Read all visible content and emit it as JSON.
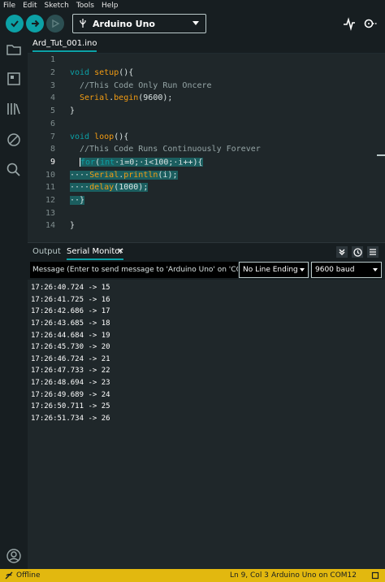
{
  "menu": [
    "File",
    "Edit",
    "Sketch",
    "Tools",
    "Help"
  ],
  "toolbar": {
    "board_label": "Arduino Uno"
  },
  "editor": {
    "file_tab": "Ard_Tut_001.ino",
    "active_line": 9,
    "lines": [
      {
        "n": "1"
      },
      {
        "n": "2"
      },
      {
        "n": "3"
      },
      {
        "n": "4"
      },
      {
        "n": "5"
      },
      {
        "n": "6"
      },
      {
        "n": "7"
      },
      {
        "n": "8"
      },
      {
        "n": "9"
      },
      {
        "n": "10"
      },
      {
        "n": "11"
      },
      {
        "n": "12"
      },
      {
        "n": "13"
      },
      {
        "n": "14"
      }
    ],
    "code": {
      "l2_kw": "void",
      "l2_fn": "setup",
      "l2_rest": "(){",
      "l3": "//This Code Only Run Oncere",
      "l4_fn": "Serial",
      "l4_dot": ".",
      "l4_fn2": "begin",
      "l4_rest": "(9600);",
      "l5": "}",
      "l7_kw": "void",
      "l7_fn": "loop",
      "l7_rest": "(){",
      "l8": "//This Code Runs Continuously Forever",
      "l9_kw": "for",
      "l9_a": "(",
      "l9_kw2": "int",
      "l9_rest": "·i=0;·i<100;·i++){",
      "l10_ind": "····",
      "l10_fn": "Serial",
      "l10_dot": ".",
      "l10_fn2": "println",
      "l10_rest": "(i);",
      "l11_ind": "····",
      "l11_fn": "delay",
      "l11_rest": "(1000);",
      "l12": "··}",
      "l14": "}"
    }
  },
  "panel": {
    "tab_output": "Output",
    "tab_serial": "Serial Monitor",
    "close": "✕",
    "message_placeholder": "Message (Enter to send message to 'Arduino Uno' on 'CO...",
    "line_ending": "No Line Ending",
    "baud": "9600 baud",
    "output": [
      "17:26:40.724 -> 15",
      "17:26:41.725 -> 16",
      "17:26:42.686 -> 17",
      "17:26:43.685 -> 18",
      "17:26:44.684 -> 19",
      "17:26:45.730 -> 20",
      "17:26:46.724 -> 21",
      "17:26:47.733 -> 22",
      "17:26:48.694 -> 23",
      "17:26:49.689 -> 24",
      "17:26:50.711 -> 25",
      "17:26:51.734 -> 26"
    ]
  },
  "status": {
    "offline": "Offline",
    "position": "Ln 9, Col 3",
    "board_port": "Arduino Uno on COM12"
  },
  "colors": {
    "accent": "#0ca1a6",
    "status_bar": "#e2b80f",
    "background": "#171e21",
    "editor_bg": "#1f272a"
  }
}
